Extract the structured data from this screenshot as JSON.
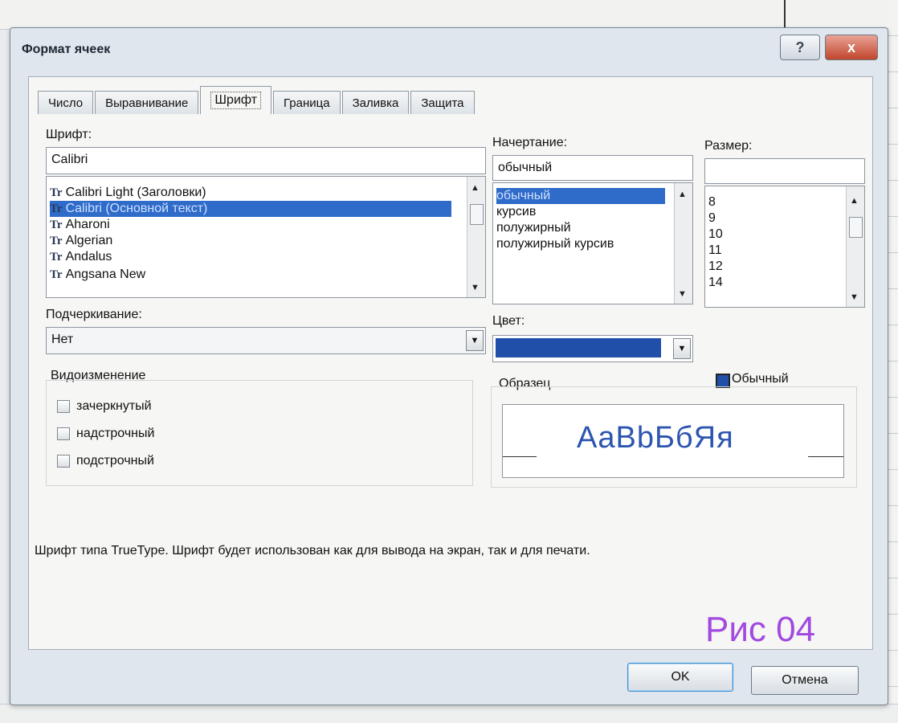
{
  "dialog": {
    "title": "Формат ячеек",
    "help_label": "?",
    "close_label": "x"
  },
  "tabs": [
    {
      "label": "Число"
    },
    {
      "label": "Выравнивание"
    },
    {
      "label": "Шрифт"
    },
    {
      "label": "Граница"
    },
    {
      "label": "Заливка"
    },
    {
      "label": "Защита"
    }
  ],
  "font": {
    "label": "Шрифт:",
    "value": "Calibri",
    "items": [
      {
        "label": "Calibri Light (Заголовки)"
      },
      {
        "label": "Calibri (Основной текст)"
      },
      {
        "label": "Aharoni"
      },
      {
        "label": "Algerian"
      },
      {
        "label": "Andalus"
      },
      {
        "label": "Angsana New"
      }
    ],
    "selected_index": 1
  },
  "style": {
    "label": "Начертание:",
    "value": "обычный",
    "items": [
      {
        "label": "обычный"
      },
      {
        "label": "курсив"
      },
      {
        "label": "полужирный"
      },
      {
        "label": "полужирный курсив"
      }
    ],
    "selected_index": 0
  },
  "size": {
    "label": "Размер:",
    "value": "",
    "items": [
      {
        "label": "8"
      },
      {
        "label": "9"
      },
      {
        "label": "10"
      },
      {
        "label": "11"
      },
      {
        "label": "12"
      },
      {
        "label": "14"
      }
    ]
  },
  "underline": {
    "label": "Подчеркивание:",
    "value": "Нет"
  },
  "color": {
    "label": "Цвет:",
    "swatch_color": "#1f4fa8",
    "normal_label": "Обычный"
  },
  "effects": {
    "label": "Видоизменение",
    "strikethrough": "зачеркнутый",
    "superscript": "надстрочный",
    "subscript": "подстрочный"
  },
  "preview": {
    "label": "Образец",
    "sample": "AaBbБбЯя"
  },
  "description": "Шрифт типа TrueType. Шрифт будет использован как для вывода на экран, так и для печати.",
  "watermark": "Рис 04",
  "buttons": {
    "ok": "OK",
    "cancel": "Отмена"
  },
  "colors": {
    "selection": "#2f6bc9",
    "sample_text": "#2c55b0",
    "watermark": "#a24ae0"
  }
}
